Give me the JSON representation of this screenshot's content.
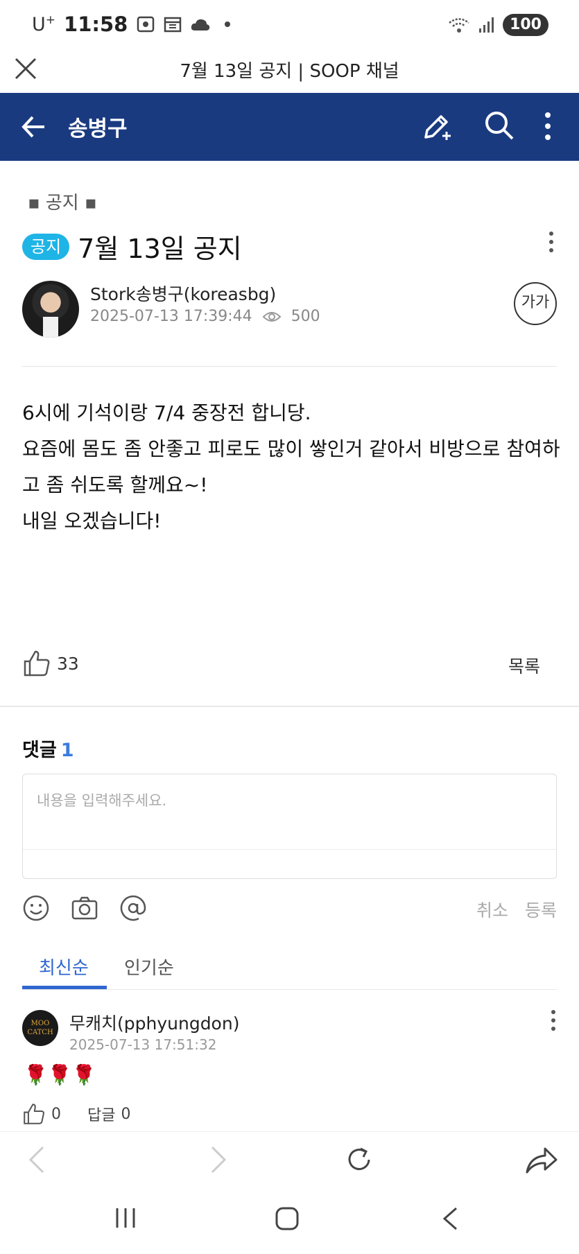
{
  "status_bar": {
    "carrier": "U",
    "carrier_sup": "+",
    "time": "11:58",
    "battery": "100"
  },
  "browser": {
    "page_title": "7월 13일 공지 | SOOP 채널"
  },
  "header": {
    "channel_name": "송병구"
  },
  "post": {
    "category": "▪ 공지 ▪",
    "badge": "공지",
    "title": "7월 13일 공지",
    "author": "Stork송병구(koreasbg)",
    "date": "2025-07-13 17:39:44",
    "views": "500",
    "font_button": "가가",
    "body": [
      "6시에 기석이랑 7/4 중장전 합니당.",
      "",
      "요즘에 몸도 좀 안좋고 피로도 많이 쌓인거 같아서 비방으로 참여하고 좀 쉬도록 할께요~!",
      "",
      "내일 오겠습니다!"
    ],
    "likes": "33",
    "list_button": "목록"
  },
  "comments": {
    "title": "댓글",
    "count": "1",
    "input_placeholder": "내용을 입력해주세요.",
    "cancel_label": "취소",
    "submit_label": "등록",
    "sort_tabs": [
      "최신순",
      "인기순"
    ],
    "items": [
      {
        "avatar_text_line1": "MOO",
        "avatar_text_line2": "CATCH",
        "author": "무캐치(pphyungdon)",
        "date": "2025-07-13 17:51:32",
        "text": "🌹🌹🌹",
        "likes": "0",
        "reply_label": "답글",
        "reply_count": "0"
      }
    ]
  },
  "colors": {
    "header_bg": "#1a3a80",
    "badge_bg": "#1fb4e6",
    "accent": "#2f66d0"
  }
}
